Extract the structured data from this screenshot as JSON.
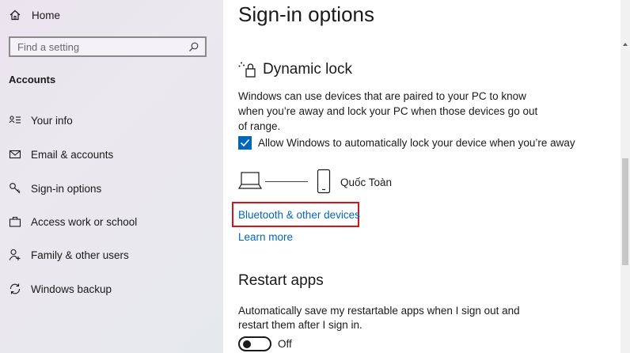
{
  "sidebar": {
    "home_label": "Home",
    "search_placeholder": "Find a setting",
    "section_title": "Accounts",
    "items": [
      {
        "label": "Your info",
        "icon": "person-card-icon"
      },
      {
        "label": "Email & accounts",
        "icon": "mail-icon"
      },
      {
        "label": "Sign-in options",
        "icon": "key-icon"
      },
      {
        "label": "Access work or school",
        "icon": "briefcase-icon"
      },
      {
        "label": "Family & other users",
        "icon": "person-add-icon"
      },
      {
        "label": "Windows backup",
        "icon": "sync-icon"
      }
    ]
  },
  "main": {
    "page_title": "Sign-in options",
    "dynamic_lock": {
      "title": "Dynamic lock",
      "description": "Windows can use devices that are paired to your PC to know when you’re away and lock your PC when those devices go out of range.",
      "checkbox_label": "Allow Windows to automatically lock your device when you’re away",
      "checkbox_checked": true,
      "device_name": "Quốc Toàn",
      "bluetooth_link": "Bluetooth & other devices",
      "learn_more": "Learn more"
    },
    "restart_apps": {
      "title": "Restart apps",
      "description": "Automatically save my restartable apps when I sign out and restart them after I sign in.",
      "toggle_state": "Off"
    }
  },
  "colors": {
    "accent": "#0067b8",
    "highlight": "#d7141a"
  }
}
